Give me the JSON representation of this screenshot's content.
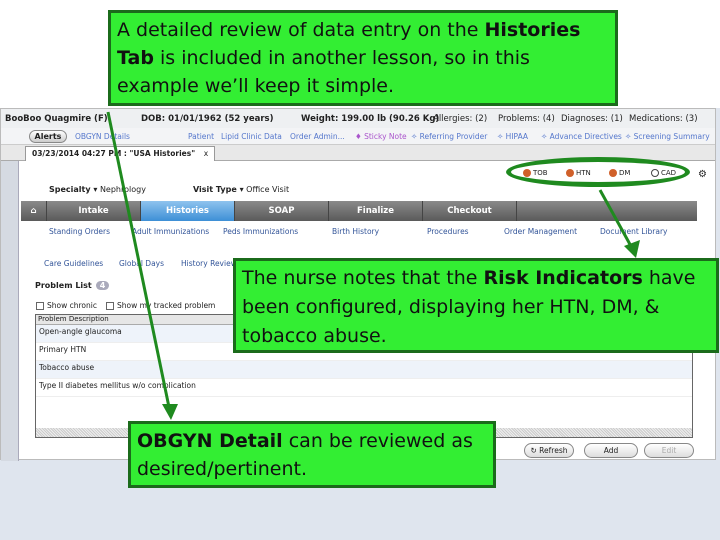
{
  "callouts": {
    "top": {
      "t1": "A detailed review of data entry on the ",
      "b1": "Histories Tab",
      "t2": " is included in another lesson, so in this example we’ll keep it simple."
    },
    "risk": {
      "t1": "The nurse notes that the ",
      "b1": "Risk Indicators",
      "t2": " have been configured, displaying her HTN, DM, & tobacco abuse."
    },
    "obgyn": {
      "b1": "OBGYN Detail",
      "t2": " can be reviewed as desired/pertinent."
    }
  },
  "patient": {
    "name": "BooBoo Quagmire (F)",
    "dob": "DOB: 01/01/1962 (52 years)",
    "weight": "Weight: 199.00 lb (90.26 Kg)",
    "allergies": "Allergies: (2)",
    "problems": "Problems: (4)",
    "diagnoses": "Diagnoses: (1)",
    "medications": "Medications: (3)"
  },
  "links": {
    "alerts": "Alerts",
    "obgyn": "OBGYN Details",
    "items": [
      "Patient",
      "Lipid Clinic Data",
      "Order Admin...",
      "♦ Sticky Note",
      "✧ Referring Provider",
      "✧ HIPAA",
      "✧ Advance Directives",
      "✧ Screening Summary"
    ]
  },
  "tab": {
    "label": "03/23/2014 04:27 PM : \"USA Histories\"",
    "close": "x"
  },
  "risk_indicators": [
    {
      "label": "TOB",
      "state": "active"
    },
    {
      "label": "HTN",
      "state": "active"
    },
    {
      "label": "DM",
      "state": "active"
    },
    {
      "label": "CAD",
      "state": "none"
    }
  ],
  "colors": {
    "risk_active": "#d0602a",
    "callout": "#33ee33",
    "highlight": "#1f8a1f"
  },
  "specialty": {
    "label": "Specialty ▾",
    "value": "Nephrology"
  },
  "visit_type": {
    "label": "Visit Type ▾",
    "value": "Office Visit"
  },
  "nav": [
    "Intake",
    "Histories",
    "SOAP",
    "Finalize",
    "Checkout"
  ],
  "subtabs": [
    "Standing Orders",
    "Adult Immunizations",
    "Peds Immunizations",
    "Birth History",
    "Procedures",
    "Order Management",
    "Document Library"
  ],
  "care": [
    "Care Guidelines",
    "Global Days",
    "History Review"
  ],
  "problem_list": {
    "title": "Problem List",
    "count": "4",
    "show_chronic": "Show chronic",
    "show_tracked": "Show my tracked problem",
    "column": "Problem Description",
    "rows": [
      "Open-angle glaucoma",
      "Primary HTN",
      "Tobacco abuse",
      "Type II diabetes mellitus w/o complication"
    ]
  },
  "buttons": {
    "refresh": "Refresh",
    "add": "Add",
    "edit": "Edit"
  }
}
